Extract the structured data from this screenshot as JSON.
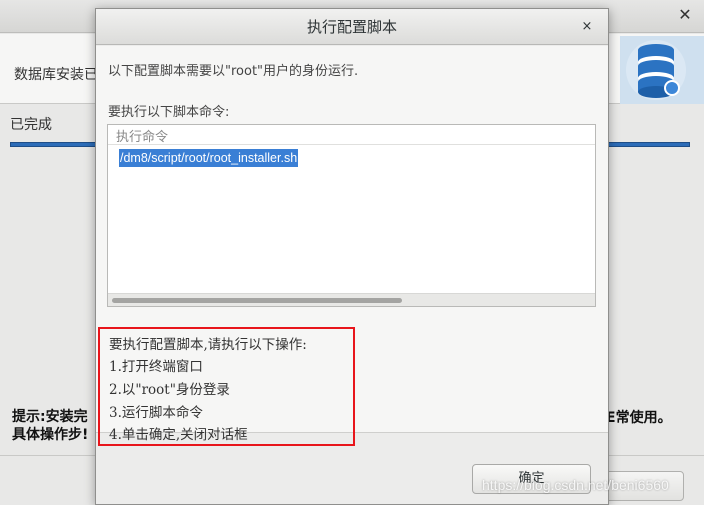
{
  "background": {
    "header_title": "数据库安装已",
    "done_label": "已完成",
    "hint_line1": "提示:安装完",
    "hint_line2": "具体操作步!",
    "hint_right": "E常使用。",
    "finish_button": "完成"
  },
  "dialog": {
    "title": "执行配置脚本",
    "close_glyph": "×",
    "intro": "以下配置脚本需要以\"root\"用户的身份运行.",
    "command_caption": "要执行以下脚本命令:",
    "table": {
      "header": "执行命令",
      "rows": [
        "/dm8/script/root/root_installer.sh"
      ]
    },
    "steps": [
      "要执行配置脚本,请执行以下操作:",
      "1.打开终端窗口",
      "2.以\"root\"身份登录",
      "3.运行脚本命令",
      "4.单击确定,关闭对话框"
    ],
    "ok_button": "确定"
  },
  "watermark": "https://blog.csdn.net/beni6560",
  "colors": {
    "selection": "#3a7fd5",
    "annotation_box": "#e8151b",
    "progress": "#2c6cb8"
  },
  "icons": {
    "close": "close-icon",
    "logo": "database-gear-icon"
  }
}
